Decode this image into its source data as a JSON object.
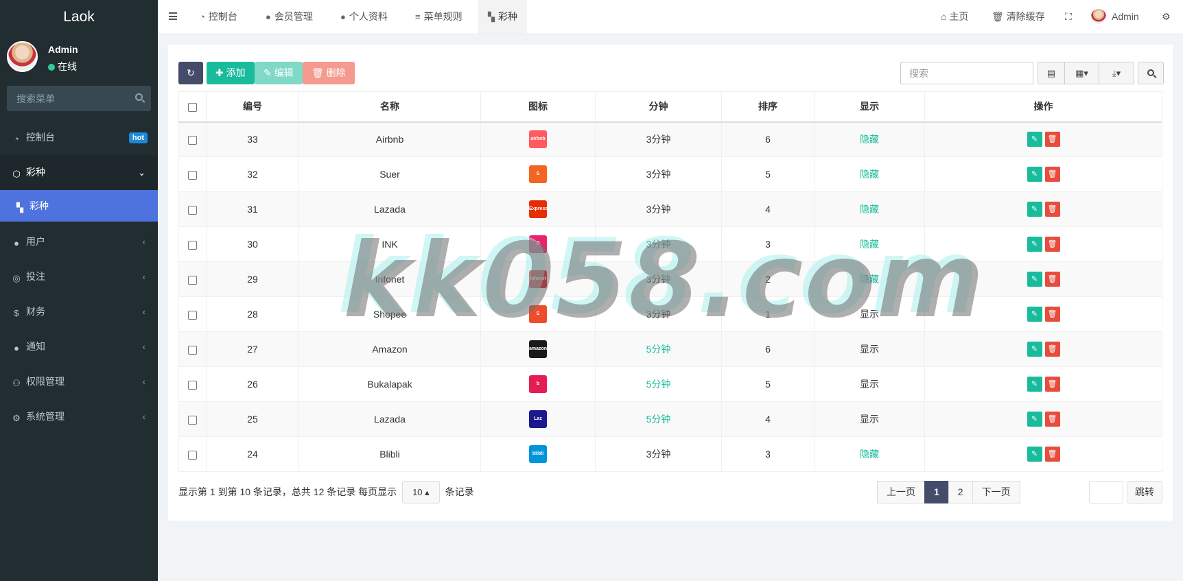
{
  "sidebar": {
    "logo": "Laok",
    "user_name": "Admin",
    "user_status": "在线",
    "search_placeholder": "搜索菜单",
    "items": [
      {
        "label": "控制台",
        "badge": "hot",
        "icon": "dashboard-icon"
      },
      {
        "label": "彩种",
        "icon": "codepen-icon"
      },
      {
        "label": "彩种",
        "icon": "checkerboard-icon"
      },
      {
        "label": "用户",
        "icon": "user-circle-icon"
      },
      {
        "label": "投注",
        "icon": "chip-icon"
      },
      {
        "label": "财务",
        "icon": "dollar-icon"
      },
      {
        "label": "通知",
        "icon": "comment-icon"
      },
      {
        "label": "权限管理",
        "icon": "users-icon"
      },
      {
        "label": "系统管理",
        "icon": "cogs-icon"
      }
    ]
  },
  "header": {
    "tabs": [
      {
        "label": "控制台",
        "icon": "dashboard-icon"
      },
      {
        "label": "会员管理",
        "icon": "user-icon"
      },
      {
        "label": "个人资料",
        "icon": "user-icon"
      },
      {
        "label": "菜单规则",
        "icon": "bars-icon"
      },
      {
        "label": "彩种",
        "icon": "checkerboard-icon"
      }
    ],
    "home": "主页",
    "clear_cache": "清除缓存",
    "admin": "Admin"
  },
  "toolbar": {
    "add": "添加",
    "edit": "编辑",
    "delete": "删除",
    "search_placeholder": "搜索"
  },
  "table": {
    "headers": [
      "编号",
      "名称",
      "图标",
      "分钟",
      "排序",
      "显示",
      "操作"
    ],
    "rows": [
      {
        "id": "33",
        "name": "Airbnb",
        "logo_text": "airbnb",
        "logo_color": "#ff5a5f",
        "minutes": "3分钟",
        "sort": "6",
        "display": "隐藏"
      },
      {
        "id": "32",
        "name": "Suer",
        "logo_text": "S",
        "logo_color": "#f26522",
        "minutes": "3分钟",
        "sort": "5",
        "display": "隐藏"
      },
      {
        "id": "31",
        "name": "Lazada",
        "logo_text": "Express",
        "logo_color": "#e62e04",
        "minutes": "3分钟",
        "sort": "4",
        "display": "隐藏"
      },
      {
        "id": "30",
        "name": "INK",
        "logo_text": "O",
        "logo_color": "#e8236b",
        "minutes": "3分钟",
        "sort": "3",
        "display": "隐藏"
      },
      {
        "id": "29",
        "name": "Infonet",
        "logo_text": "Infonet",
        "logo_color": "#e50914",
        "minutes": "3分钟",
        "sort": "2",
        "display": "隐藏"
      },
      {
        "id": "28",
        "name": "Shopee",
        "logo_text": "S",
        "logo_color": "#ee4d2d",
        "minutes": "3分钟",
        "sort": "1",
        "display": "显示"
      },
      {
        "id": "27",
        "name": "Amazon",
        "logo_text": "amazon",
        "logo_color": "#1a1a1a",
        "minutes": "5分钟",
        "sort": "6",
        "display": "显示"
      },
      {
        "id": "26",
        "name": "Bukalapak",
        "logo_text": "b",
        "logo_color": "#e31e52",
        "minutes": "5分钟",
        "sort": "5",
        "display": "显示"
      },
      {
        "id": "25",
        "name": "Lazada",
        "logo_text": "Laz",
        "logo_color": "#1a1a8e",
        "minutes": "5分钟",
        "sort": "4",
        "display": "显示"
      },
      {
        "id": "24",
        "name": "Blibli",
        "logo_text": "blibli",
        "logo_color": "#0095da",
        "minutes": "3分钟",
        "sort": "3",
        "display": "隐藏"
      }
    ]
  },
  "footer": {
    "info_prefix": "显示第 1 到第 10 条记录，总共 12 条记录 每页显示",
    "page_size": "10",
    "info_suffix": "条记录",
    "prev": "上一页",
    "pages": [
      "1",
      "2"
    ],
    "next": "下一页",
    "jump": "跳转"
  },
  "watermark": "kk058.com",
  "colors": {
    "sidebar_bg": "#222d32",
    "active_menu": "#4e73df",
    "primary": "#444c69",
    "success": "#18bc9c",
    "danger": "#e74c3c"
  }
}
